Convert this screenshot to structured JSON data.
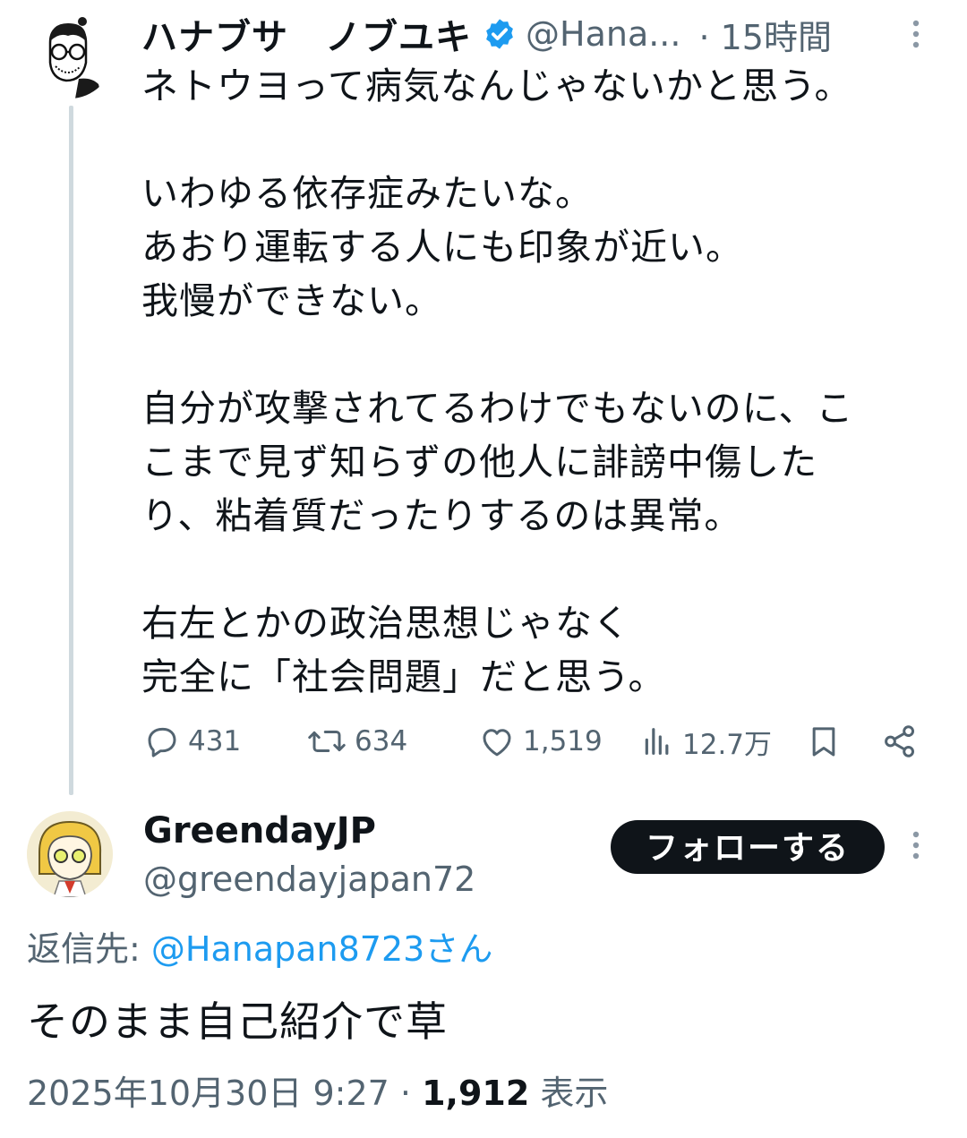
{
  "tweet1": {
    "display_name": "ハナブサ　ノブユキ",
    "handle": "@Hana...",
    "time": "· 15時間",
    "lines": [
      "ネトウヨって病気なんじゃないかと思う。",
      "",
      "いわゆる依存症みたいな。",
      "あおり運転する人にも印象が近い。",
      "我慢ができない。",
      "",
      "自分が攻撃されてるわけでもないのに、こ",
      "こまで見ず知らずの他人に誹謗中傷した",
      "り、粘着質だったりするのは異常。",
      "",
      "右左とかの政治思想じゃなく",
      "完全に「社会問題」だと思う。"
    ],
    "stats": {
      "replies": "431",
      "retweets": "634",
      "likes": "1,519",
      "views": "12.7万"
    },
    "colors": {
      "verified": "#1d9bf0",
      "muted": "#536471"
    }
  },
  "tweet2": {
    "display_name": "GreendayJP",
    "handle": "@greendayjapan72",
    "follow_label": "フォローする",
    "reply_prefix": "返信先: ",
    "reply_mention": "@Hanapan8723さん",
    "text": "そのまま自己紹介で草",
    "timestamp": "2025年10月30日 9:27 · ",
    "view_count": "1,912",
    "view_label": " 表示"
  },
  "icons": [
    "more-icon",
    "verified-badge-icon",
    "reply-icon",
    "retweet-icon",
    "like-icon",
    "views-icon",
    "bookmark-icon",
    "share-icon"
  ]
}
